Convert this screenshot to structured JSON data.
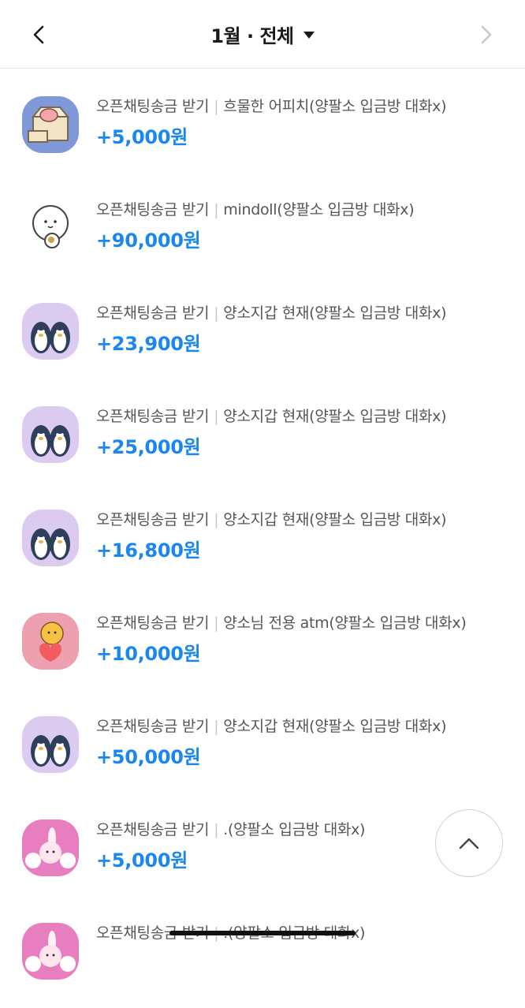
{
  "header": {
    "title": "1월 · 전체",
    "back_icon": "chevron-left-icon",
    "forward_icon": "chevron-right-icon",
    "dropdown_icon": "caret-down-icon"
  },
  "transactions": [
    {
      "type": "오픈채팅송금 받기",
      "sender": "흐물한 어피치(양팔소 입금방 대화x)",
      "amount": "+5,000원",
      "avatar": "apeach-box-icon",
      "bg": "#7f98d8"
    },
    {
      "type": "오픈채팅송금 받기",
      "sender": "mindoll(양팔소 입금방 대화x)",
      "amount": "+90,000원",
      "avatar": "ghost-character-icon",
      "bg": "#ffffff"
    },
    {
      "type": "오픈채팅송금 받기",
      "sender": "양소지갑 현재(양팔소 입금방 대화x)",
      "amount": "+23,900원",
      "avatar": "penguins-icon",
      "bg": "#dccbf0"
    },
    {
      "type": "오픈채팅송금 받기",
      "sender": "양소지갑 현재(양팔소 입금방 대화x)",
      "amount": "+25,000원",
      "avatar": "penguins-icon",
      "bg": "#dccbf0"
    },
    {
      "type": "오픈채팅송금 받기",
      "sender": "양소지갑 현재(양팔소 입금방 대화x)",
      "amount": "+16,800원",
      "avatar": "penguins-icon",
      "bg": "#dccbf0"
    },
    {
      "type": "오픈채팅송금 받기",
      "sender": "양소님 전용 atm(양팔소 입금방 대화x)",
      "amount": "+10,000원",
      "avatar": "bear-heart-icon",
      "bg": "#efa0b0"
    },
    {
      "type": "오픈채팅송금 받기",
      "sender": "양소지갑 현재(양팔소 입금방 대화x)",
      "amount": "+50,000원",
      "avatar": "penguins-icon",
      "bg": "#dccbf0"
    },
    {
      "type": "오픈채팅송금 받기",
      "sender": ".(양팔소 입금방 대화x)",
      "amount": "+5,000원",
      "avatar": "bunny-cheer-icon",
      "bg": "#e67ec0"
    },
    {
      "type": "오픈채팅송금 받기",
      "sender": ".(양팔소 입금방 대화x)",
      "amount": "",
      "avatar": "bunny-cheer-icon",
      "bg": "#e67ec0"
    }
  ],
  "scroll_top_icon": "chevron-up-icon"
}
